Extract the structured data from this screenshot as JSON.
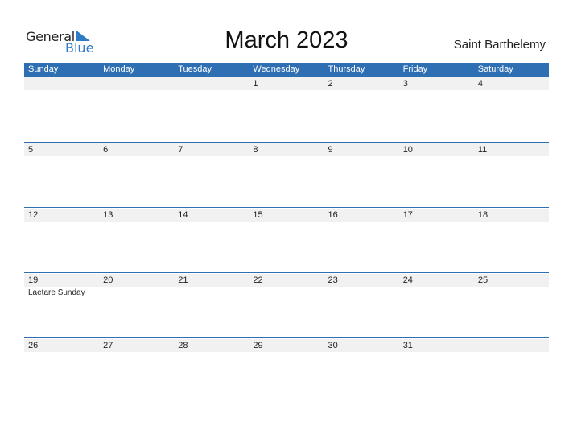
{
  "logo": {
    "general": "General",
    "blue": "Blue"
  },
  "title": "March 2023",
  "region": "Saint Barthelemy",
  "weekdays": [
    "Sunday",
    "Monday",
    "Tuesday",
    "Wednesday",
    "Thursday",
    "Friday",
    "Saturday"
  ],
  "weeks": [
    [
      "",
      "",
      "",
      "1",
      "2",
      "3",
      "4"
    ],
    [
      "5",
      "6",
      "7",
      "8",
      "9",
      "10",
      "11"
    ],
    [
      "12",
      "13",
      "14",
      "15",
      "16",
      "17",
      "18"
    ],
    [
      "19",
      "20",
      "21",
      "22",
      "23",
      "24",
      "25"
    ],
    [
      "26",
      "27",
      "28",
      "29",
      "30",
      "31",
      ""
    ]
  ],
  "events": {
    "19": "Laetare Sunday"
  }
}
